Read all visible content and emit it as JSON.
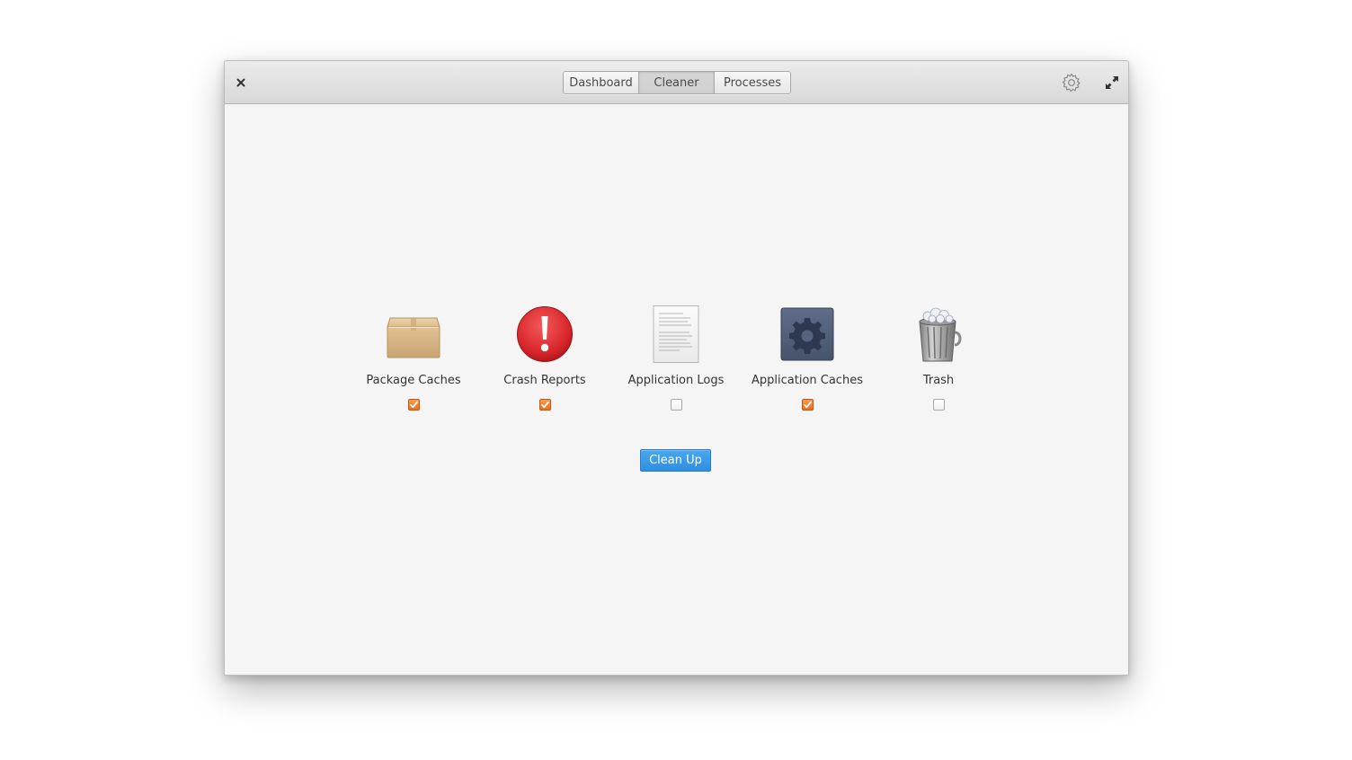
{
  "header": {
    "tabs": [
      {
        "label": "Dashboard",
        "active": false
      },
      {
        "label": "Cleaner",
        "active": true
      },
      {
        "label": "Processes",
        "active": false
      }
    ],
    "icons": {
      "close": "close-icon",
      "settings": "gear-icon",
      "fullscreen": "fullscreen-icon"
    }
  },
  "cleaner": {
    "items": [
      {
        "label": "Package Caches",
        "icon": "package-box-icon",
        "checked": true
      },
      {
        "label": "Crash Reports",
        "icon": "crash-warning-icon",
        "checked": true
      },
      {
        "label": "Application Logs",
        "icon": "text-document-icon",
        "checked": false
      },
      {
        "label": "Application Caches",
        "icon": "app-cache-gear-icon",
        "checked": true
      },
      {
        "label": "Trash",
        "icon": "trash-can-icon",
        "checked": false
      }
    ],
    "clean_button_label": "Clean Up"
  },
  "colors": {
    "accent": "#3892e3",
    "checkbox_checked": "#f07e2a",
    "crash_red": "#d9262b",
    "cache_tile": "#4f5d78"
  }
}
